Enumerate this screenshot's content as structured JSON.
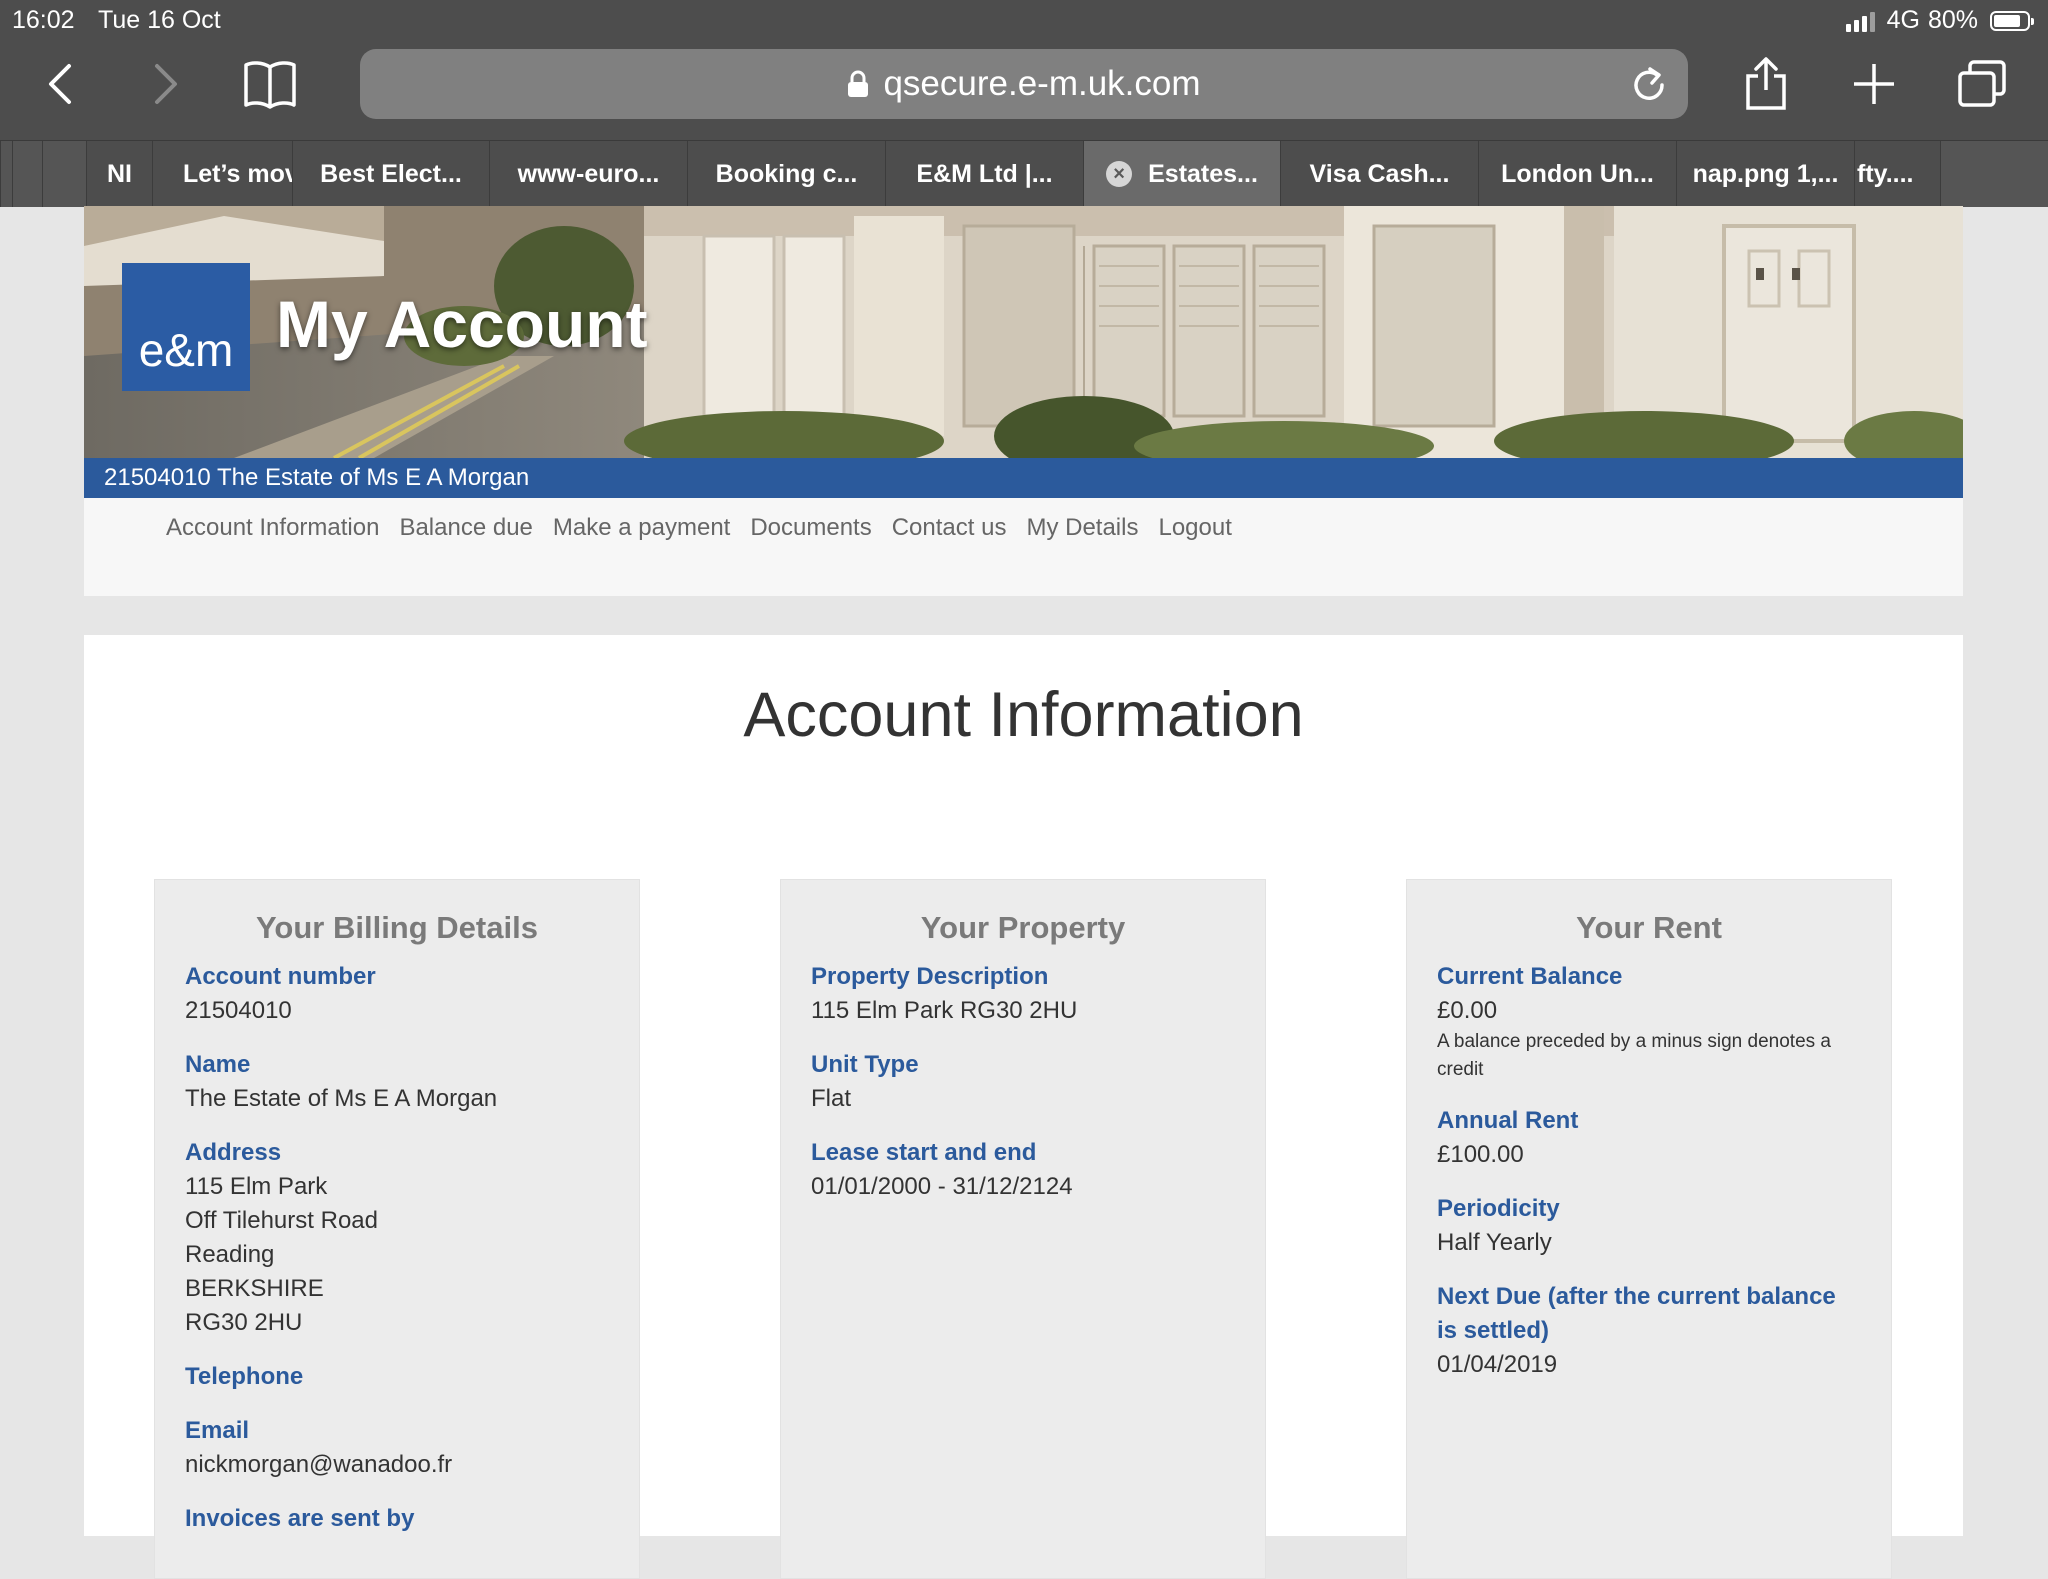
{
  "status_bar": {
    "time": "16:02",
    "date": "Tue 16 Oct",
    "network": "4G",
    "battery_percent": "80%",
    "battery_level": 0.8
  },
  "browser": {
    "url": "qsecure.e-m.uk.com",
    "icons": [
      "back-icon",
      "forward-icon",
      "bookmarks-icon",
      "lock-icon",
      "reload-icon",
      "share-icon",
      "new-tab-icon",
      "tabs-icon"
    ],
    "tabs": [
      {
        "label": "NI"
      },
      {
        "label": "Let’s mov"
      },
      {
        "label": "Best Elect..."
      },
      {
        "label": "www-euro..."
      },
      {
        "label": "Booking c..."
      },
      {
        "label": "E&M Ltd |..."
      },
      {
        "label": "Estates...",
        "active": true
      },
      {
        "label": "Visa Cash..."
      },
      {
        "label": "London Un..."
      },
      {
        "label": "nap.png 1,..."
      },
      {
        "label": "fty...."
      }
    ]
  },
  "header": {
    "logo_text": "e&m",
    "title": "My Account",
    "account_line": "21504010 The Estate of Ms E A Morgan",
    "brand_color": "#2b5a9c"
  },
  "nav": {
    "items": [
      "Account Information",
      "Balance due",
      "Make a payment",
      "Documents",
      "Contact us",
      "My Details",
      "Logout"
    ]
  },
  "main": {
    "page_title": "Account Information",
    "billing": {
      "heading": "Your Billing Details",
      "account_number_label": "Account number",
      "account_number": "21504010",
      "name_label": "Name",
      "name": "The Estate of Ms E A Morgan",
      "address_label": "Address",
      "address_lines": [
        "115 Elm Park",
        "Off Tilehurst Road",
        "Reading",
        "BERKSHIRE",
        "RG30 2HU"
      ],
      "telephone_label": "Telephone",
      "email_label": "Email",
      "email": "nickmorgan@wanadoo.fr",
      "invoices_label": "Invoices are sent by"
    },
    "property": {
      "heading": "Your Property",
      "description_label": "Property Description",
      "description": "115 Elm Park RG30 2HU",
      "unit_type_label": "Unit Type",
      "unit_type": "Flat",
      "lease_label": "Lease start and end",
      "lease": "01/01/2000 - 31/12/2124"
    },
    "rent": {
      "heading": "Your Rent",
      "balance_label": "Current Balance",
      "balance": "£0.00",
      "balance_note": "A balance preceded by a minus sign denotes a credit",
      "annual_label": "Annual Rent",
      "annual": "£100.00",
      "periodicity_label": "Periodicity",
      "periodicity": "Half Yearly",
      "next_due_label": "Next Due (after the current balance is settled)",
      "next_due": "01/04/2019"
    }
  }
}
